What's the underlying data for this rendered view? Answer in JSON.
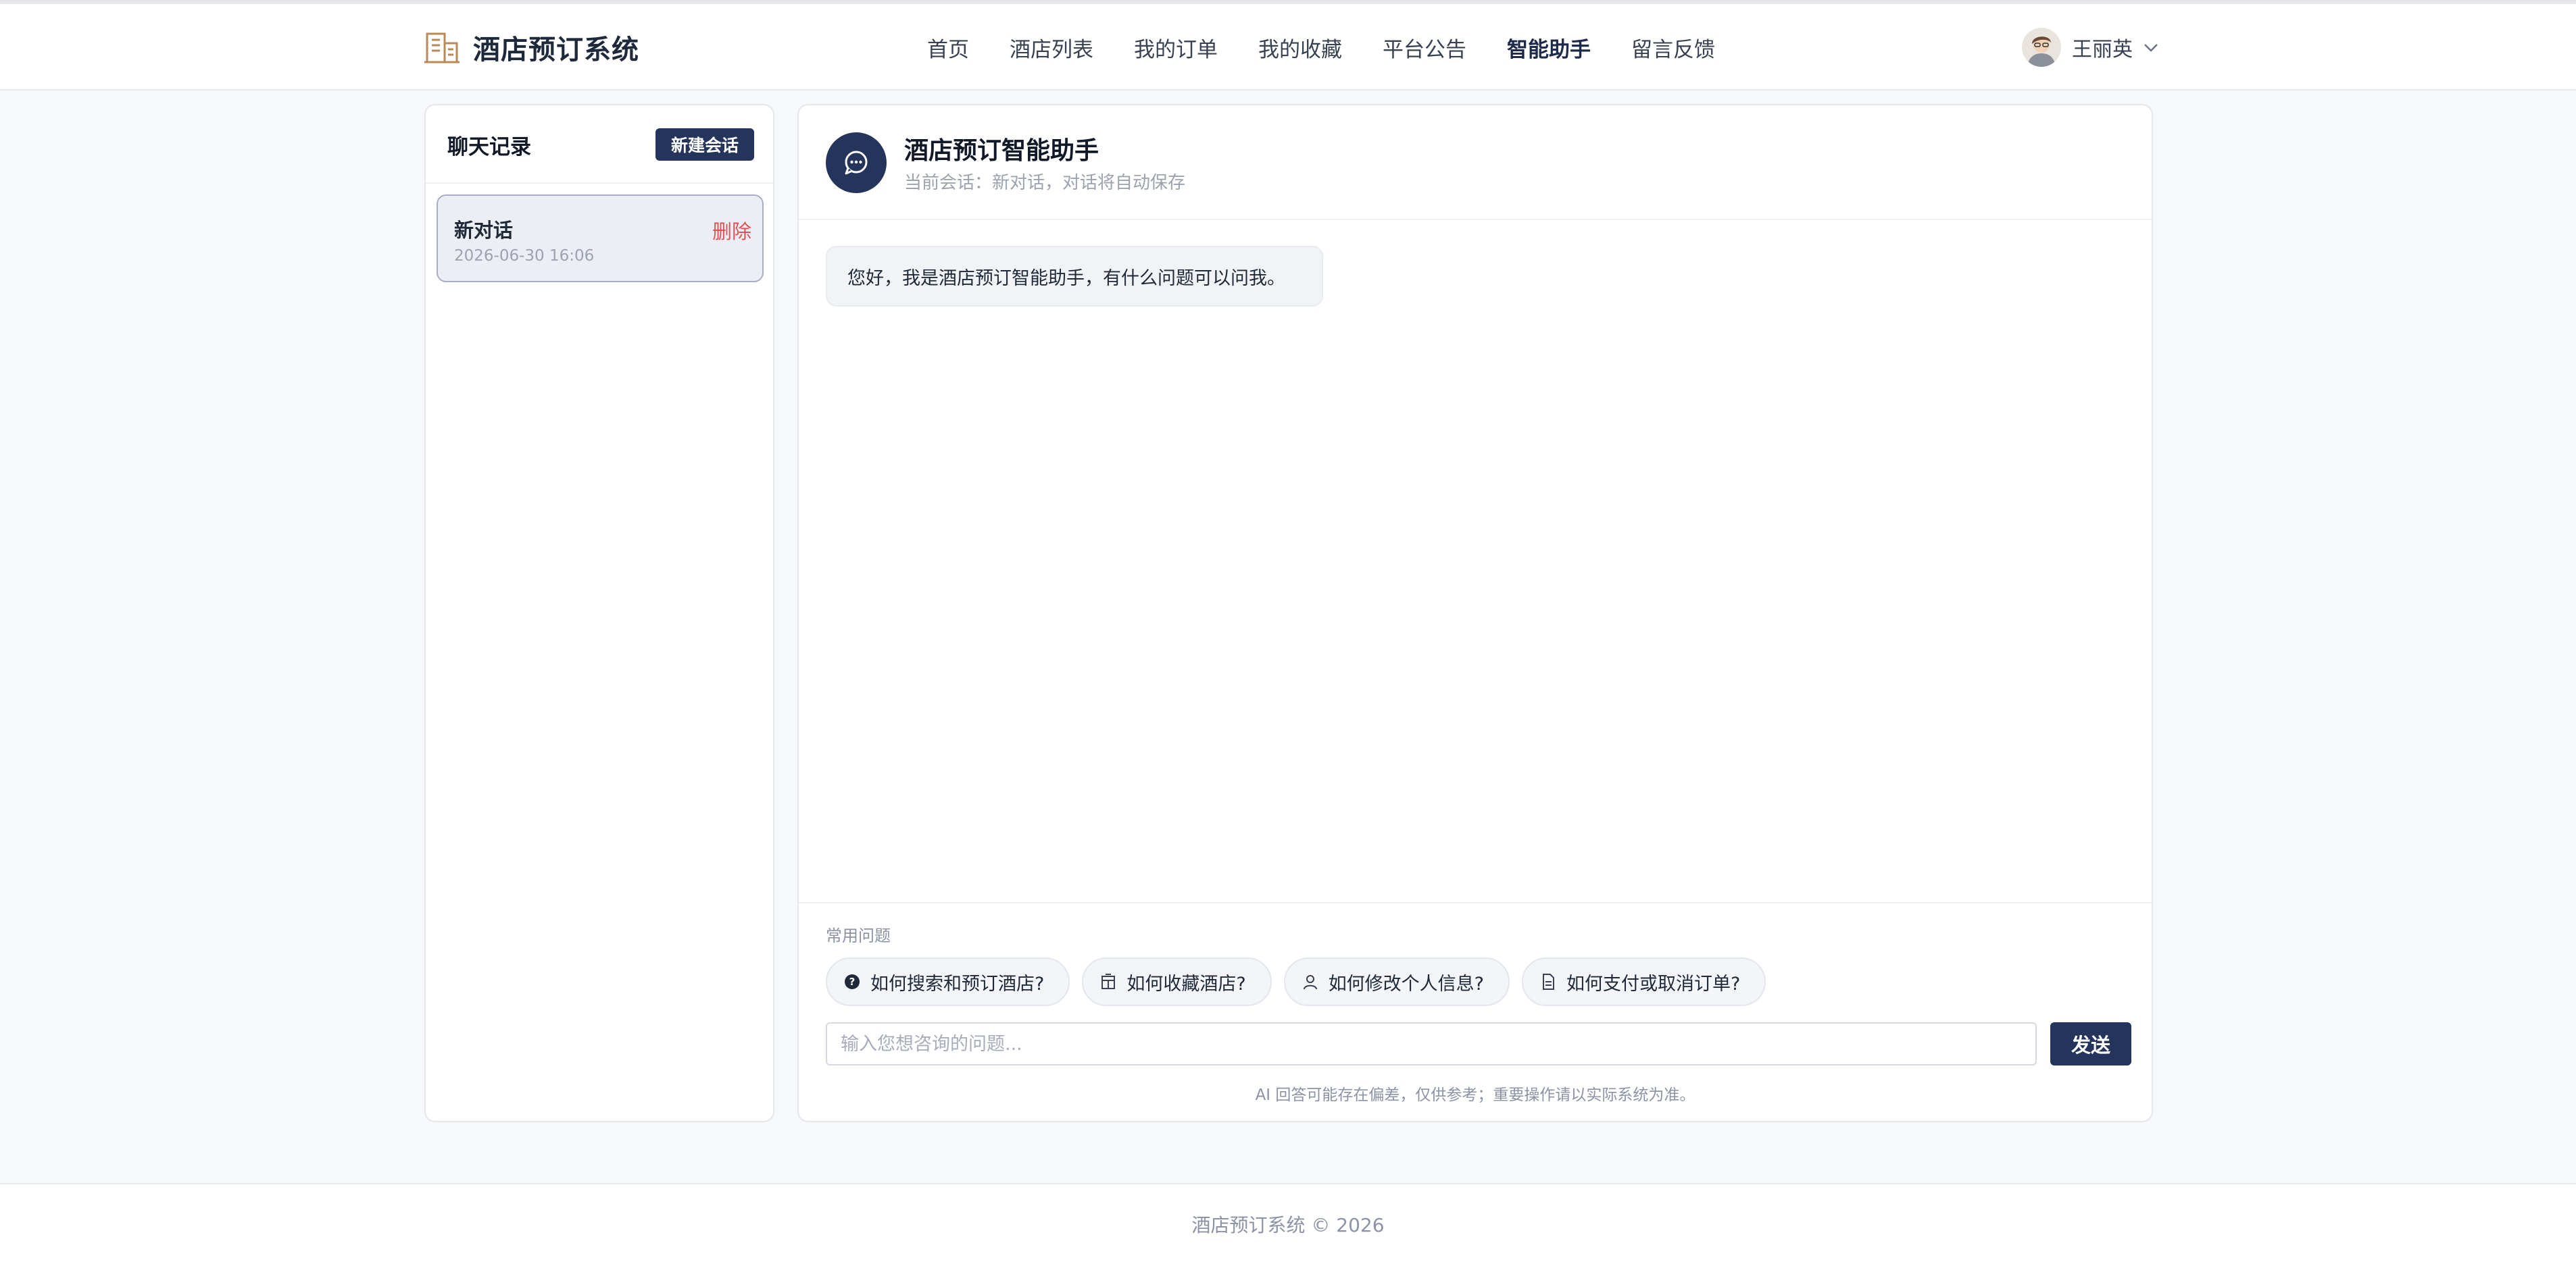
{
  "app": {
    "title": "酒店预订系统",
    "logo_icon": "hotel-building-icon"
  },
  "colors": {
    "primary": "#25345a",
    "logo_accent": "#b98a57",
    "danger": "#e05252",
    "selected_bg": "#eceef5"
  },
  "nav": {
    "items": [
      {
        "label": "首页",
        "active": false
      },
      {
        "label": "酒店列表",
        "active": false
      },
      {
        "label": "我的订单",
        "active": false
      },
      {
        "label": "我的收藏",
        "active": false
      },
      {
        "label": "平台公告",
        "active": false
      },
      {
        "label": "智能助手",
        "active": true
      },
      {
        "label": "留言反馈",
        "active": false
      }
    ]
  },
  "user": {
    "name": "王丽英",
    "avatar_icon": "user-avatar",
    "dropdown_icon": "chevron-down-icon"
  },
  "sidebar": {
    "title": "聊天记录",
    "new_button": "新建会话",
    "conversations": [
      {
        "title": "新对话",
        "time": "2026-06-30 16:06",
        "delete_label": "删除",
        "selected": true
      }
    ]
  },
  "chat": {
    "title": "酒店预订智能助手",
    "subtitle": "当前会话：新对话，对话将自动保存",
    "bot_icon": "chat-bubble-icon",
    "messages": [
      {
        "role": "assistant",
        "text": "您好，我是酒店预订智能助手，有什么问题可以问我。"
      }
    ],
    "faq_label": "常用问题",
    "faq": [
      {
        "label": "如何搜索和预订酒店?",
        "icon": "question-circle-icon"
      },
      {
        "label": "如何收藏酒店?",
        "icon": "building-icon"
      },
      {
        "label": "如何修改个人信息?",
        "icon": "user-icon"
      },
      {
        "label": "如何支付或取消订单?",
        "icon": "document-icon"
      }
    ],
    "input_placeholder": "输入您想咨询的问题...",
    "input_value": "",
    "send_label": "发送",
    "disclaimer": "AI 回答可能存在偏差，仅供参考；重要操作请以实际系统为准。"
  },
  "footer": {
    "text": "酒店预订系统 © 2026"
  }
}
